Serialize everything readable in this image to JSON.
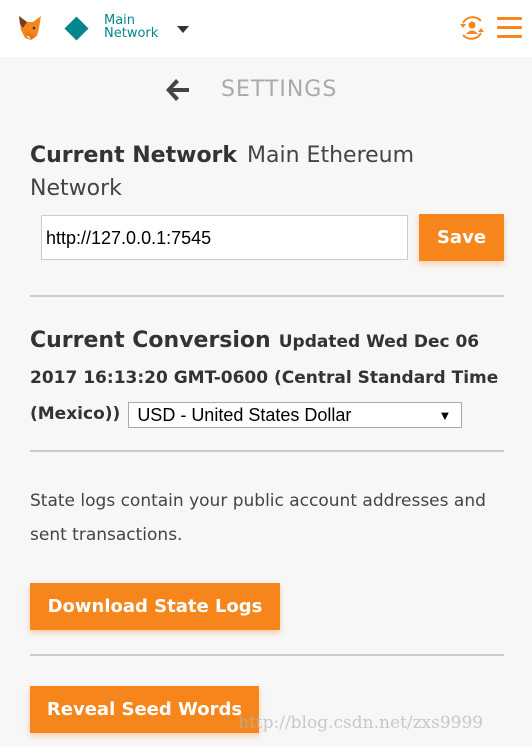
{
  "header": {
    "network_line1": "Main",
    "network_line2": "Network",
    "network_color": "#038789",
    "accent": "#f6851b"
  },
  "settings": {
    "title": "SETTINGS",
    "current_network_label": "Current Network",
    "current_network_value": "Main Ethereum Network",
    "rpc_value": "http://127.0.0.1:7545",
    "save_label": "Save",
    "current_conversion_label": "Current Conversion",
    "updated_text": "Updated Wed Dec 06 2017 16:13:20 GMT-0600 (Central Standard Time (Mexico))",
    "currency_selected": "USD - United States Dollar",
    "state_logs_desc": "State logs contain your public account addresses and sent transactions.",
    "download_label": "Download State Logs",
    "reveal_label": "Reveal Seed Words"
  },
  "watermark": "http://blog.csdn.net/zxs9999"
}
